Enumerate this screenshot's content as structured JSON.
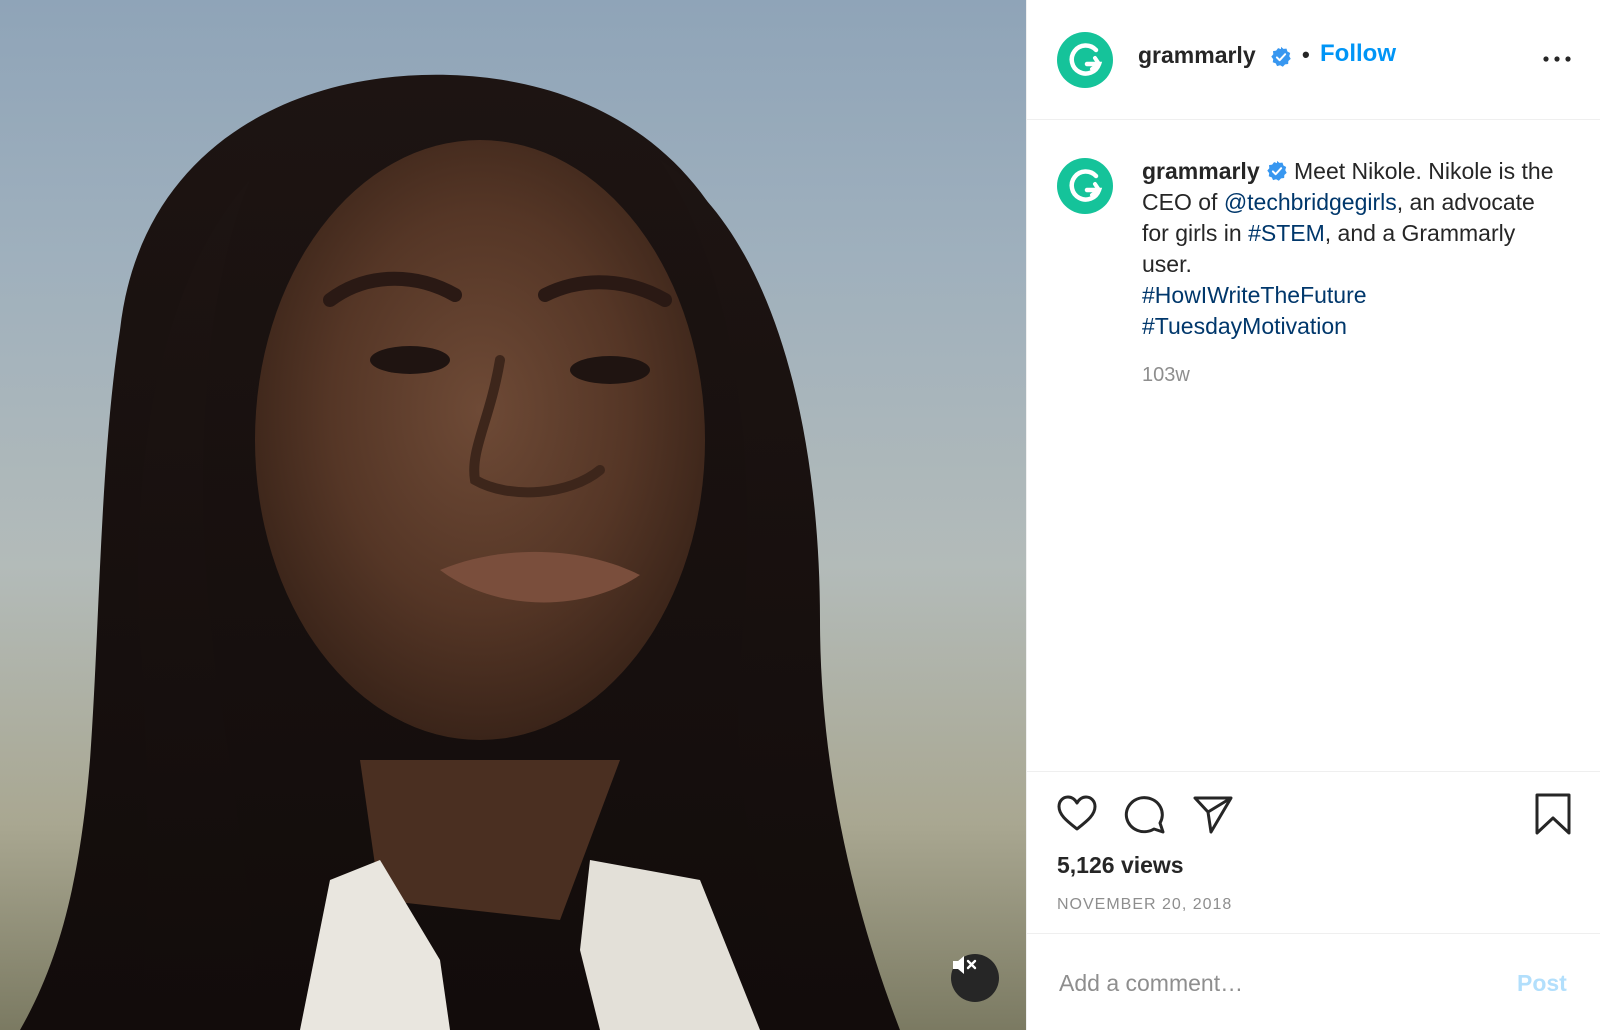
{
  "post": {
    "username": "grammarly",
    "follow_label": "Follow",
    "separator": "•",
    "caption": {
      "username": "grammarly",
      "text_1": " Meet Nikole. Nikole is the CEO of ",
      "mention": "@techbridgegirls",
      "text_2": ", an advocate for girls in ",
      "hashtag_stem": "#STEM",
      "text_3": ", and a Grammarly user.",
      "hashtag_1": "#HowIWriteTheFuture",
      "hashtag_2": "#TuesdayMotivation"
    },
    "age": "103w",
    "views": "5,126 views",
    "date": "NOVEMBER 20, 2018",
    "comment_placeholder": "Add a comment…",
    "post_label": "Post"
  },
  "colors": {
    "brand_green": "#15c39a",
    "link_blue": "#0095f6",
    "hashtag_blue": "#00376b",
    "post_disabled": "#b2dffc"
  },
  "icons": [
    "verified-badge-icon",
    "more-options-icon",
    "heart-icon",
    "comment-icon",
    "share-icon",
    "bookmark-icon",
    "mute-icon"
  ]
}
